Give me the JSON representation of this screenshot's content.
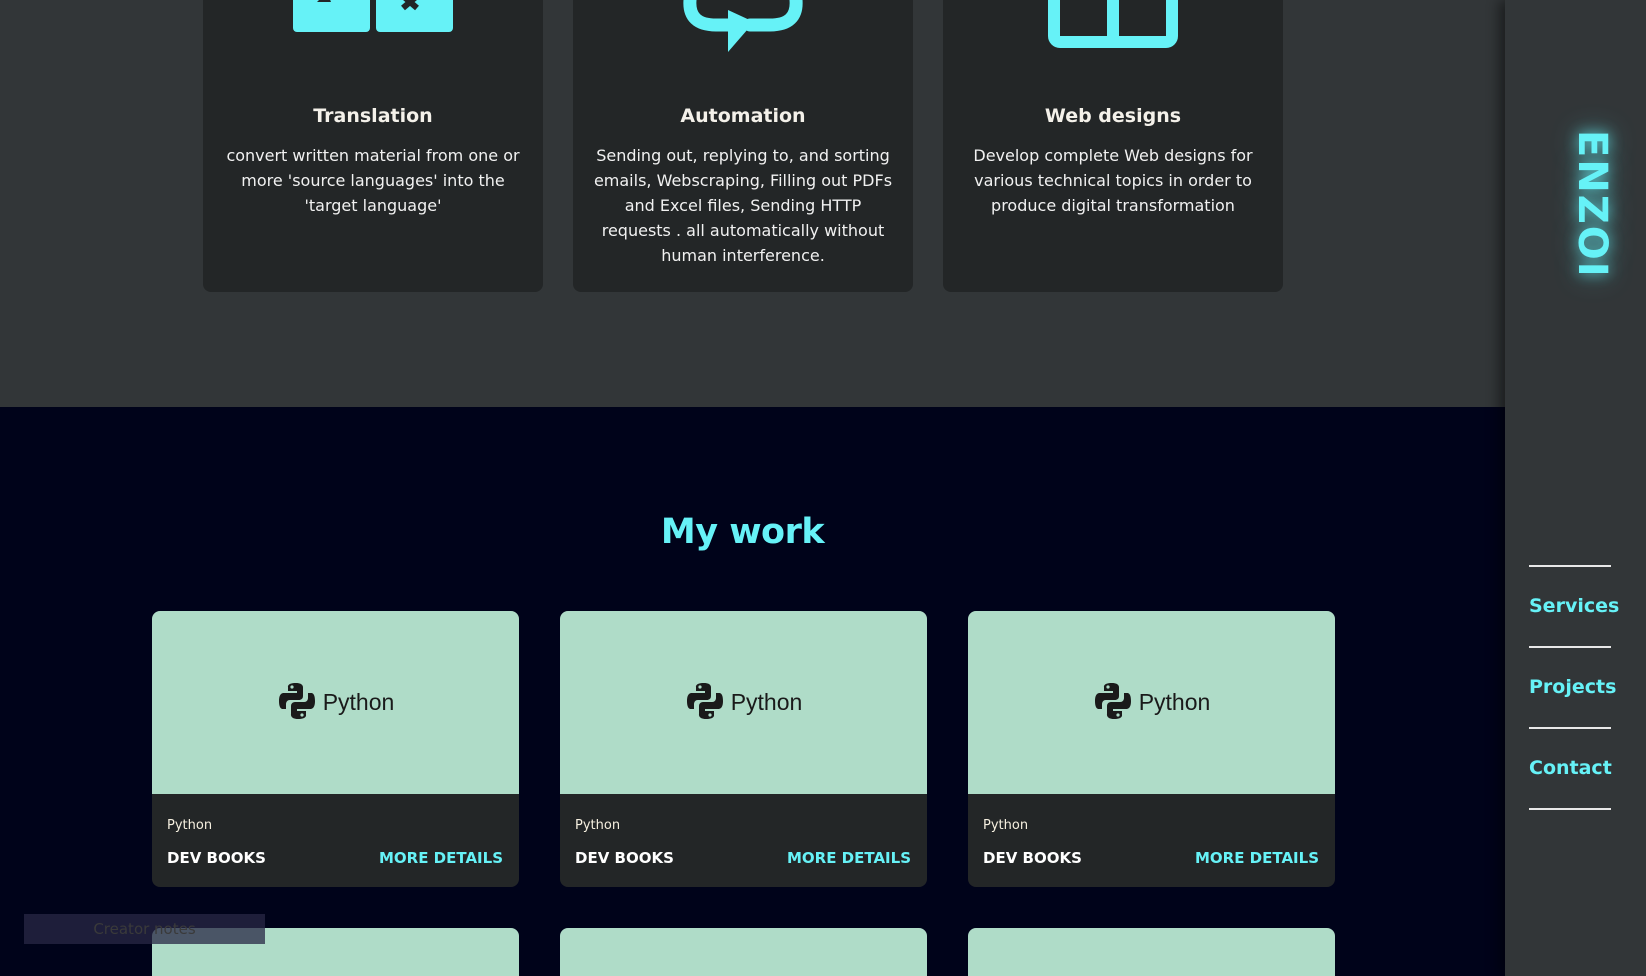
{
  "services": [
    {
      "title": "Translation",
      "description": "convert written material from one or more 'source languages' into the 'target language'",
      "icon": "translate-icon"
    },
    {
      "title": "Automation",
      "description": "Sending out, replying to, and sorting emails, Webscraping, Filling out PDFs and Excel files, Sending HTTP requests . all automatically without human interference.",
      "icon": "refresh-icon"
    },
    {
      "title": "Web designs",
      "description": "Develop complete Web designs for various technical topics in order to produce digital transformation",
      "icon": "layout-icon"
    }
  ],
  "work": {
    "title": "My work",
    "cards": [
      {
        "thumb_label": "Python",
        "tag": "Python",
        "name": "DEV BOOKS",
        "action": "MORE DETAILS"
      },
      {
        "thumb_label": "Python",
        "tag": "Python",
        "name": "DEV BOOKS",
        "action": "MORE DETAILS"
      },
      {
        "thumb_label": "Python",
        "tag": "Python",
        "name": "DEV BOOKS",
        "action": "MORE DETAILS"
      }
    ]
  },
  "creator_notes": "Creator notes",
  "sidebar": {
    "brand": "ENZOI",
    "nav": [
      {
        "label": "Services"
      },
      {
        "label": "Projects"
      },
      {
        "label": "Contact"
      }
    ]
  },
  "colors": {
    "accent": "#66f2f7",
    "section_bg": "#323638",
    "card_bg": "#232627",
    "page_bg": "#00031a",
    "thumb_bg": "#afdcc8"
  }
}
